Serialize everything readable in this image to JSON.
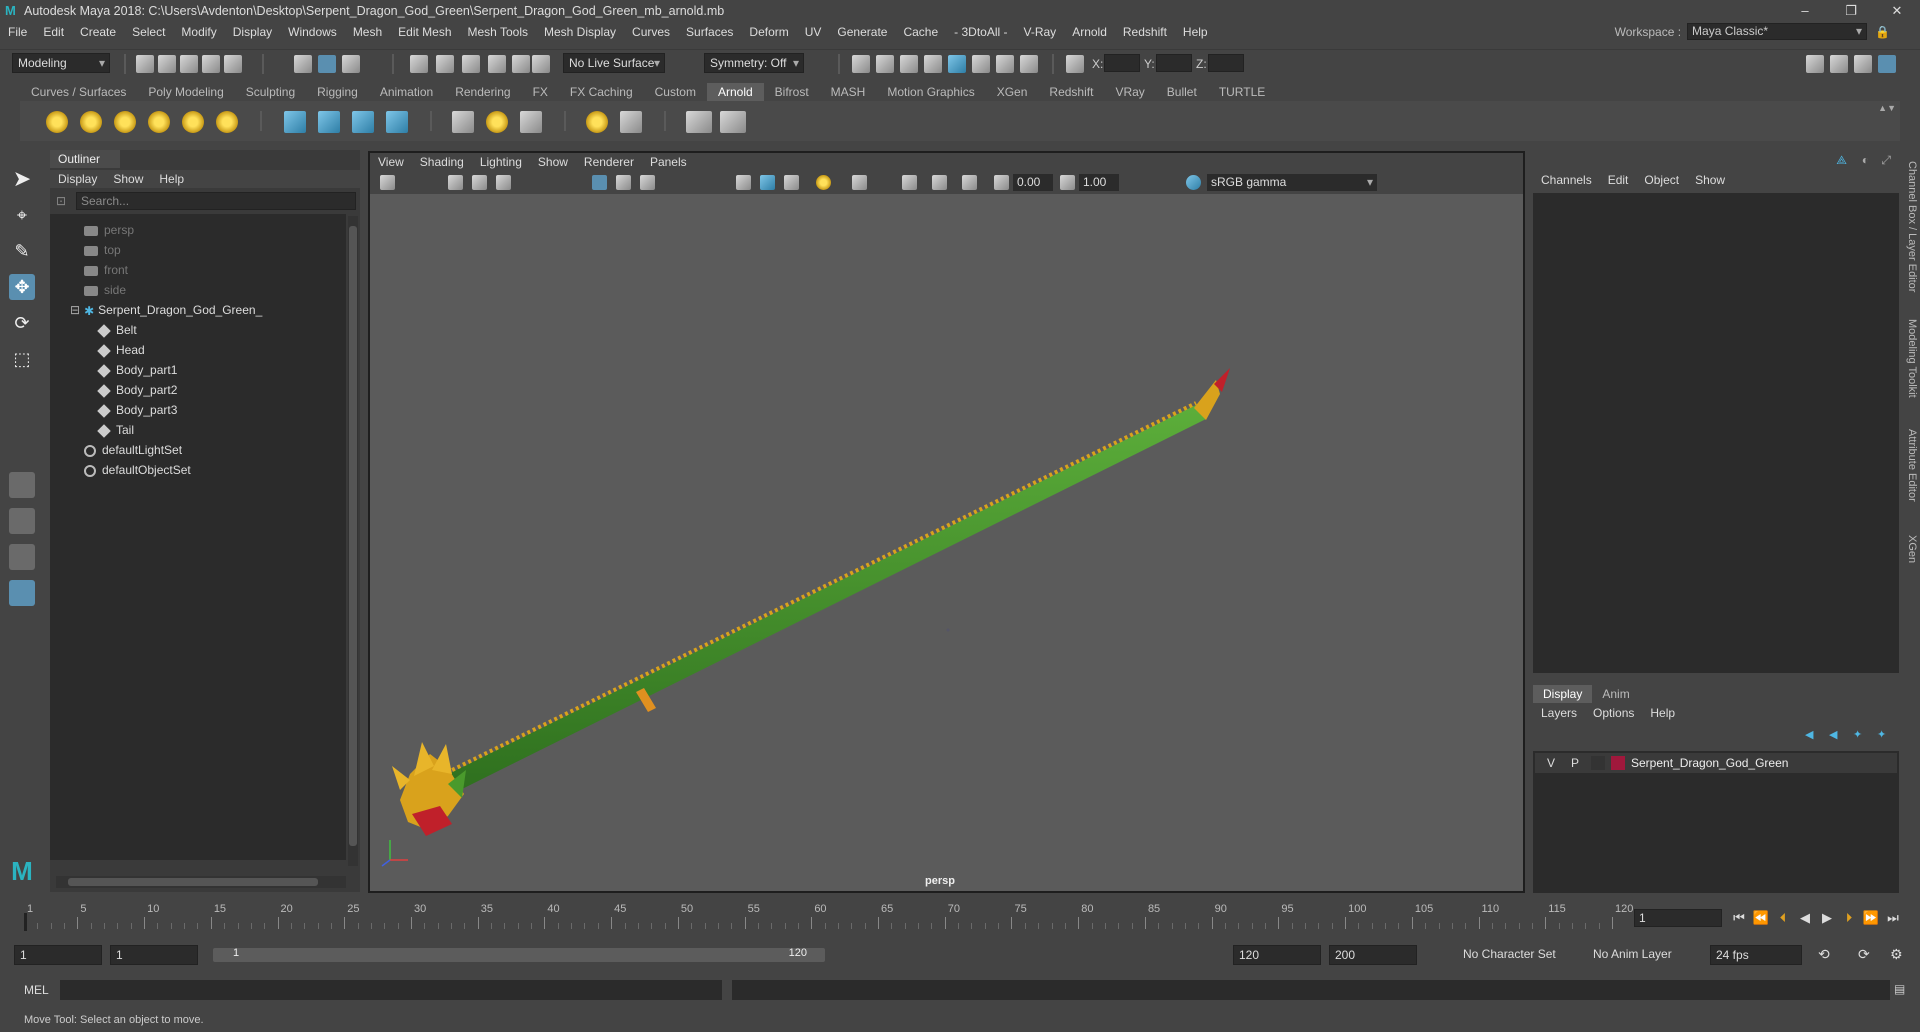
{
  "window": {
    "title": "Autodesk Maya 2018: C:\\Users\\Avdenton\\Desktop\\Serpent_Dragon_God_Green\\Serpent_Dragon_God_Green_mb_arnold.mb",
    "minimize": "–",
    "maximize": "❐",
    "close": "✕"
  },
  "menubar": {
    "items": [
      "File",
      "Edit",
      "Create",
      "Select",
      "Modify",
      "Display",
      "Windows",
      "Mesh",
      "Edit Mesh",
      "Mesh Tools",
      "Mesh Display",
      "Curves",
      "Surfaces",
      "Deform",
      "UV",
      "Generate",
      "Cache",
      "- 3DtoAll -",
      "V-Ray",
      "Arnold",
      "Redshift",
      "Help"
    ],
    "workspace_label": "Workspace :",
    "workspace_value": "Maya Classic*"
  },
  "statusline": {
    "mode": "Modeling",
    "live_surface": "No Live Surface",
    "symmetry": "Symmetry: Off",
    "x_label": "X:",
    "y_label": "Y:",
    "z_label": "Z:"
  },
  "shelf": {
    "tabs": [
      "Curves / Surfaces",
      "Poly Modeling",
      "Sculpting",
      "Rigging",
      "Animation",
      "Rendering",
      "FX",
      "FX Caching",
      "Custom",
      "Arnold",
      "Bifrost",
      "MASH",
      "Motion Graphics",
      "XGen",
      "Redshift",
      "VRay",
      "Bullet",
      "TURTLE"
    ],
    "active": "Arnold"
  },
  "outliner": {
    "tab": "Outliner",
    "menu": [
      "Display",
      "Show",
      "Help"
    ],
    "search_placeholder": "Search...",
    "items": [
      {
        "label": "persp",
        "kind": "camera",
        "dim": true
      },
      {
        "label": "top",
        "kind": "camera",
        "dim": true
      },
      {
        "label": "front",
        "kind": "camera",
        "dim": true
      },
      {
        "label": "side",
        "kind": "camera",
        "dim": true
      },
      {
        "label": "Serpent_Dragon_God_Green_",
        "kind": "group",
        "dim": false
      },
      {
        "label": "Belt",
        "kind": "mesh",
        "dim": false
      },
      {
        "label": "Head",
        "kind": "mesh",
        "dim": false
      },
      {
        "label": "Body_part1",
        "kind": "mesh",
        "dim": false
      },
      {
        "label": "Body_part2",
        "kind": "mesh",
        "dim": false
      },
      {
        "label": "Body_part3",
        "kind": "mesh",
        "dim": false
      },
      {
        "label": "Tail",
        "kind": "mesh",
        "dim": false
      },
      {
        "label": "defaultLightSet",
        "kind": "set",
        "dim": false
      },
      {
        "label": "defaultObjectSet",
        "kind": "set",
        "dim": false
      }
    ]
  },
  "viewport": {
    "menu": [
      "View",
      "Shading",
      "Lighting",
      "Show",
      "Renderer",
      "Panels"
    ],
    "exposure": "0.00",
    "gamma_value": "1.00",
    "colorspace": "sRGB gamma",
    "camera_label": "persp"
  },
  "channelbox": {
    "menu": [
      "Channels",
      "Edit",
      "Object",
      "Show"
    ],
    "layer_tabs": [
      "Display",
      "Anim"
    ],
    "layer_active": "Display",
    "layer_menu": [
      "Layers",
      "Options",
      "Help"
    ],
    "layer": {
      "v": "V",
      "p": "P",
      "name": "Serpent_Dragon_God_Green",
      "color": "#a0183c"
    },
    "side_tabs": [
      "Channel Box / Layer Editor",
      "Modeling Toolkit",
      "Attribute Editor",
      "XGen"
    ]
  },
  "timeslider": {
    "labels": [
      "1",
      "5",
      "10",
      "15",
      "20",
      "25",
      "30",
      "35",
      "40",
      "45",
      "50",
      "55",
      "60",
      "65",
      "70",
      "75",
      "80",
      "85",
      "90",
      "95",
      "100",
      "105",
      "110",
      "115",
      "120"
    ],
    "current_frame": "1"
  },
  "range": {
    "start": "1",
    "anim_start": "1",
    "range_lo": "1",
    "range_hi": "120",
    "end": "120",
    "anim_end": "200",
    "character_set": "No Character Set",
    "anim_layer": "No Anim Layer",
    "fps": "24 fps"
  },
  "cmdline": {
    "label": "MEL"
  },
  "helpline": {
    "message": "Move Tool: Select an object to move."
  },
  "colors": {
    "accent": "#5a8fb0",
    "serpent_green": "#3f8f2a",
    "serpent_gold": "#d9a21c"
  }
}
